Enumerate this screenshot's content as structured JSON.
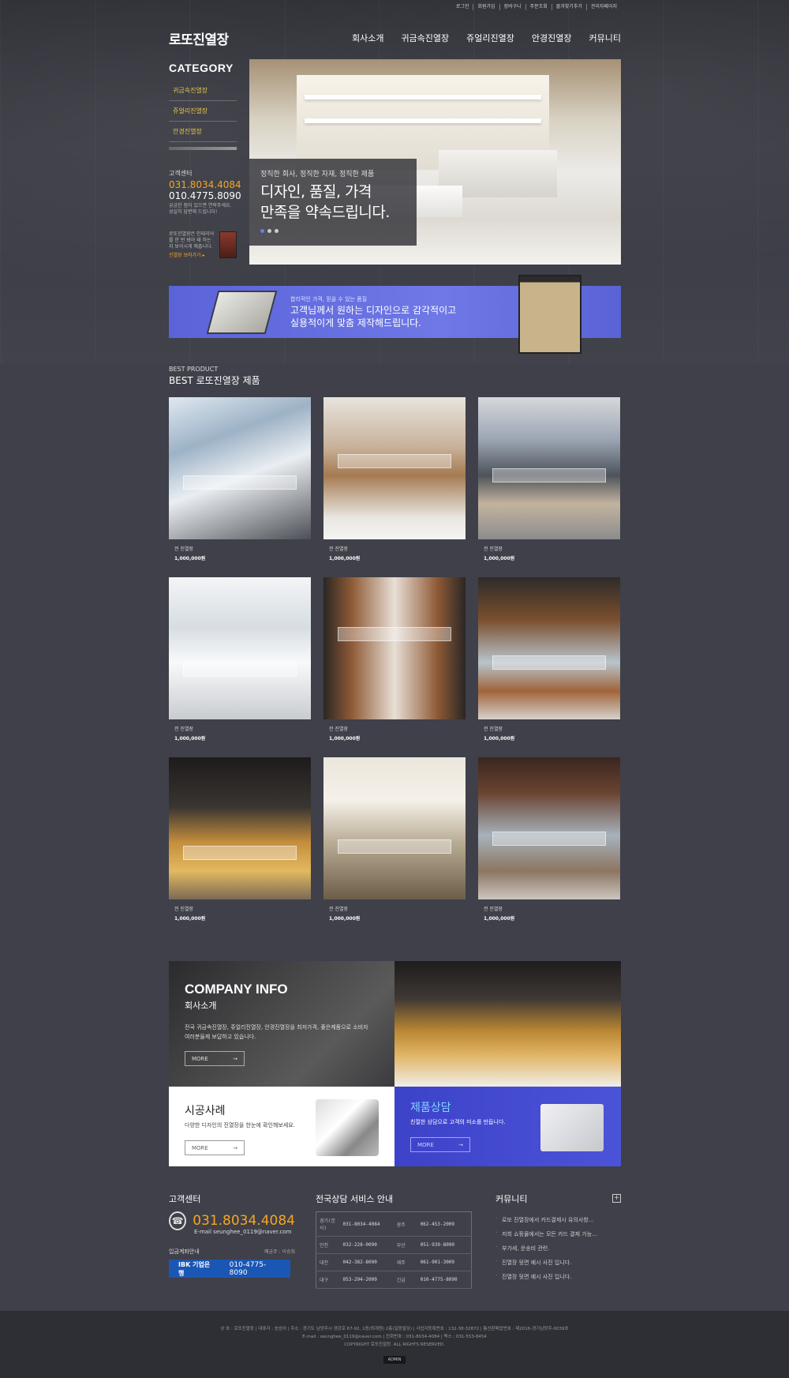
{
  "util_links": [
    "로그인",
    "회원가입",
    "장바구니",
    "주문조회",
    "즐겨찾기추가",
    "관리자페이지"
  ],
  "logo": "로또진열장",
  "gnb": [
    "회사소개",
    "귀금속진열장",
    "쥬얼리진열장",
    "안경진열장",
    "커뮤니티"
  ],
  "sidebar": {
    "title": "CATEGORY",
    "items": [
      "귀금속진열장",
      "쥬얼리진열장",
      "안경진열장"
    ],
    "cs_title": "고객센터",
    "cs_phone1": "031.8034.4084",
    "cs_phone2": "010.4775.8090",
    "cs_desc": "궁금한 점이 있으면 연락주세요. 성실히 답변해 드립니다!",
    "book_text": "로또진열장은 인테리어를 한 번 봐야 돼 하는지 보이시게 해줍니다.",
    "book_link": "진열장 보러가기 ▸"
  },
  "hero": {
    "sub": "정직한 회사, 정직한 자재, 정직한 제품",
    "main_line1": "디자인, 품질, 가격",
    "main_line2": "만족을 약속드립니다."
  },
  "banner": {
    "sub": "합리적인 가격, 믿을 수 있는 품질",
    "main_line1": "고객님께서 원하는 디자인으로 감각적이고",
    "main_line2": "실용적이게 맞춤 제작해드립니다."
  },
  "best": {
    "label": "BEST PRODUCT",
    "title": "BEST 로또진열장 제품",
    "products": [
      {
        "name": "전 진열장",
        "price": "1,000,000원"
      },
      {
        "name": "전 진열장",
        "price": "1,000,000원"
      },
      {
        "name": "전 진열장",
        "price": "1,000,000원"
      },
      {
        "name": "전 진열장",
        "price": "1,000,000원"
      },
      {
        "name": "전 진열장",
        "price": "1,000,000원"
      },
      {
        "name": "전 진열장",
        "price": "1,000,000원"
      },
      {
        "name": "전 진열장",
        "price": "1,000,000원"
      },
      {
        "name": "전 진열장",
        "price": "1,000,000원"
      },
      {
        "name": "전 진열장",
        "price": "1,000,000원"
      }
    ]
  },
  "company": {
    "title": "COMPANY INFO",
    "title_ko": "회사소개",
    "desc": "전국 귀금속진열장, 쥬얼리진열장, 안경진열장을 최저가격, 좋은제품으로 소비자 여러분들께 보답하고 있습니다.",
    "more": "MORE",
    "case_title": "시공사례",
    "case_desc": "다양한 디자인의 진열장을 한눈에 확인해보세요.",
    "consult_title": "제품상담",
    "consult_desc": "친절한 상담으로 고객의 미소를 만듭니다."
  },
  "footer_cs": {
    "title": "고객센터",
    "phone": "031.8034.4084",
    "email": "E-mail seunghee_0119@naver.com",
    "account_label": "입금계좌안내",
    "account_holder": "예금주 : 이승희",
    "bank": "IBK 기업은행",
    "account": "010-4775-8090"
  },
  "service": {
    "title": "전국상담 서비스 안내",
    "rows": [
      [
        "경기(본사)",
        "031-8034-4084",
        "광주",
        "062-453-2009"
      ],
      [
        "인천",
        "032-228-0090",
        "부산",
        "051-939-8090"
      ],
      [
        "대전",
        "042-382-8090",
        "제주",
        "061-901-3009"
      ],
      [
        "대구",
        "053-294-2009",
        "긴급",
        "010-4775-8090"
      ]
    ]
  },
  "community": {
    "title": "커뮤니티",
    "items": [
      "로또 진열장에서 카드결제시 유의사항...",
      "저희 쇼핑몰에서는 모든 카드 결제 가능...",
      "부가세, 운송비 관련.",
      "진열장 뒷면 예시 사진 입니다.",
      "진열장 뒷면 예시 사진 입니다."
    ]
  },
  "footer": {
    "line1": "상 호 : 로또진열장 | 대표자 : 송승아 | 주소 : 경기도 남양주시 경강로 67-92, 1동(퇴계원) 2층(일동빌딩) | 사업자등록번호 : 132-38-32872 | 통신판매업번호 : 제2016-경기남양주-0039호",
    "line2": "E-mail : seunghee_0119@naver.com | 전화번호 : 031-8034-4084 | 팩스 : 031-553-8454",
    "line3": "COPYRIGHT 로또진열장. ALL RIGHTS RESERVED.",
    "admin": "ADMIN"
  }
}
